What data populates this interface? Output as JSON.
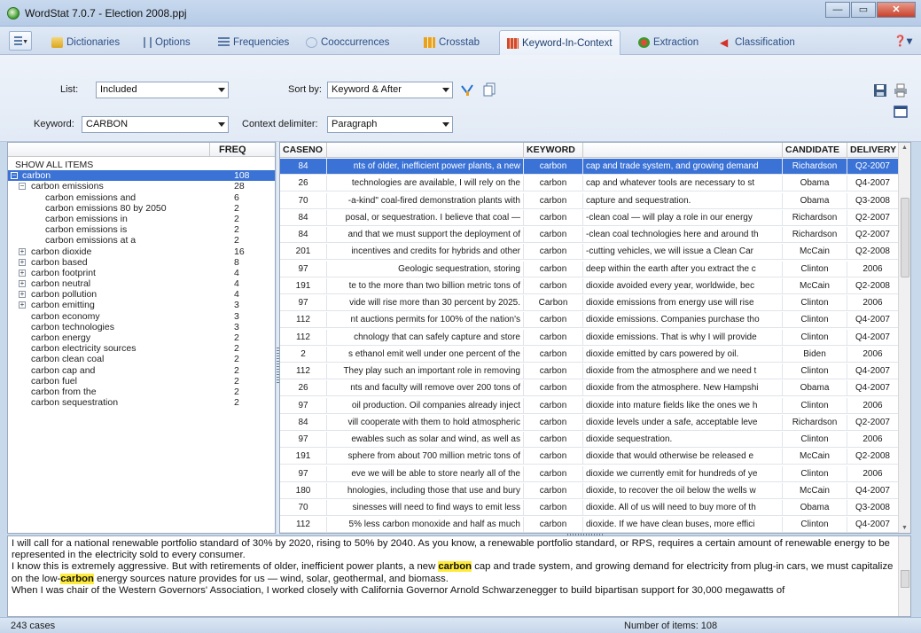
{
  "window": {
    "title": "WordStat 7.0.7 - Election 2008.ppj"
  },
  "tabs": [
    {
      "label": "Dictionaries",
      "icon": "book-icon"
    },
    {
      "label": "Options",
      "icon": "options-icon"
    },
    {
      "label": "Frequencies",
      "icon": "list-icon"
    },
    {
      "label": "Cooccurrences",
      "icon": "network-icon"
    },
    {
      "label": "Crosstab",
      "icon": "table-icon"
    },
    {
      "label": "Keyword-In-Context",
      "icon": "kwic-icon"
    },
    {
      "label": "Extraction",
      "icon": "extraction-icon"
    },
    {
      "label": "Classification",
      "icon": "classification-icon"
    }
  ],
  "toolbar": {
    "list_label": "List:",
    "list_value": "Included",
    "keyword_label": "Keyword:",
    "keyword_value": "CARBON",
    "sort_label": "Sort by:",
    "sort_value": "Keyword & After",
    "context_label": "Context delimiter:",
    "context_value": "Paragraph"
  },
  "left_panel": {
    "freq_header": "FREQ",
    "show_all": "SHOW ALL ITEMS",
    "items": [
      {
        "label": "carbon",
        "count": "108",
        "level": 0,
        "expander": "−",
        "selected": true
      },
      {
        "label": "carbon emissions",
        "count": "28",
        "level": 1,
        "expander": "−"
      },
      {
        "label": "carbon emissions and",
        "count": "6",
        "level": 2,
        "expander": ""
      },
      {
        "label": "carbon emissions 80 by 2050",
        "count": "2",
        "level": 2,
        "expander": ""
      },
      {
        "label": "carbon emissions in",
        "count": "2",
        "level": 2,
        "expander": ""
      },
      {
        "label": "carbon emissions is",
        "count": "2",
        "level": 2,
        "expander": ""
      },
      {
        "label": "carbon emissions at a",
        "count": "2",
        "level": 2,
        "expander": ""
      },
      {
        "label": "carbon dioxide",
        "count": "16",
        "level": 1,
        "expander": "+"
      },
      {
        "label": "carbon based",
        "count": "8",
        "level": 1,
        "expander": "+"
      },
      {
        "label": "carbon footprint",
        "count": "4",
        "level": 1,
        "expander": "+"
      },
      {
        "label": "carbon neutral",
        "count": "4",
        "level": 1,
        "expander": "+"
      },
      {
        "label": "carbon pollution",
        "count": "4",
        "level": 1,
        "expander": "+"
      },
      {
        "label": "carbon emitting",
        "count": "3",
        "level": 1,
        "expander": "+"
      },
      {
        "label": "carbon economy",
        "count": "3",
        "level": 1,
        "expander": ""
      },
      {
        "label": "carbon technologies",
        "count": "3",
        "level": 1,
        "expander": ""
      },
      {
        "label": "carbon energy",
        "count": "2",
        "level": 1,
        "expander": ""
      },
      {
        "label": "carbon electricity sources",
        "count": "2",
        "level": 1,
        "expander": ""
      },
      {
        "label": "carbon clean coal",
        "count": "2",
        "level": 1,
        "expander": ""
      },
      {
        "label": "carbon cap and",
        "count": "2",
        "level": 1,
        "expander": ""
      },
      {
        "label": "carbon fuel",
        "count": "2",
        "level": 1,
        "expander": ""
      },
      {
        "label": "carbon from the",
        "count": "2",
        "level": 1,
        "expander": ""
      },
      {
        "label": "carbon sequestration",
        "count": "2",
        "level": 1,
        "expander": ""
      }
    ]
  },
  "grid": {
    "headers": {
      "caseno": "CASENO",
      "keyword": "KEYWORD",
      "candidate": "CANDIDATE",
      "delivery": "DELIVERY"
    },
    "rows": [
      {
        "caseno": "84",
        "left": "nts of older, inefficient power plants, a new",
        "keyword": "carbon",
        "right": "cap and trade system, and growing demand",
        "candidate": "Richardson",
        "delivery": "Q2-2007",
        "selected": true
      },
      {
        "caseno": "26",
        "left": "technologies are available, I will rely on the",
        "keyword": "carbon",
        "right": "cap and whatever tools are necessary to st",
        "candidate": "Obama",
        "delivery": "Q4-2007"
      },
      {
        "caseno": "70",
        "left": "-a-kind\" coal-fired demonstration plants with",
        "keyword": "carbon",
        "right": "capture and sequestration.",
        "candidate": "Obama",
        "delivery": "Q3-2008"
      },
      {
        "caseno": "84",
        "left": "posal, or sequestration. I believe that coal —",
        "keyword": "carbon",
        "right": "-clean coal — will play a role in our energy",
        "candidate": "Richardson",
        "delivery": "Q2-2007"
      },
      {
        "caseno": "84",
        "left": "and that we must support the deployment of",
        "keyword": "carbon",
        "right": "-clean coal technologies here and around th",
        "candidate": "Richardson",
        "delivery": "Q2-2007"
      },
      {
        "caseno": "201",
        "left": "incentives and credits for hybrids and other",
        "keyword": "carbon",
        "right": "-cutting vehicles, we will issue a Clean Car",
        "candidate": "McCain",
        "delivery": "Q2-2008"
      },
      {
        "caseno": "97",
        "left": "Geologic sequestration, storing",
        "keyword": "carbon",
        "right": "deep within the earth after you extract the c",
        "candidate": "Clinton",
        "delivery": "2006"
      },
      {
        "caseno": "191",
        "left": "te to the more than two billion metric tons of",
        "keyword": "carbon",
        "right": "dioxide avoided every year, worldwide, bec",
        "candidate": "McCain",
        "delivery": "Q2-2008"
      },
      {
        "caseno": "97",
        "left": "vide will rise more than 30 percent by 2025.",
        "keyword": "Carbon",
        "right": "dioxide emissions from energy use will rise",
        "candidate": "Clinton",
        "delivery": "2006"
      },
      {
        "caseno": "112",
        "left": "nt auctions permits for 100% of the nation's",
        "keyword": "carbon",
        "right": "dioxide emissions. Companies purchase tho",
        "candidate": "Clinton",
        "delivery": "Q4-2007"
      },
      {
        "caseno": "112",
        "left": "chnology that can safely capture and store",
        "keyword": "carbon",
        "right": "dioxide emissions. That is why I will provide",
        "candidate": "Clinton",
        "delivery": "Q4-2007"
      },
      {
        "caseno": "2",
        "left": "s ethanol emit well under one percent of the",
        "keyword": "carbon",
        "right": "dioxide emitted by cars powered by oil.",
        "candidate": "Biden",
        "delivery": "2006"
      },
      {
        "caseno": "112",
        "left": "They play such an important role in removing",
        "keyword": "carbon",
        "right": "dioxide from the atmosphere and we need t",
        "candidate": "Clinton",
        "delivery": "Q4-2007"
      },
      {
        "caseno": "26",
        "left": "nts and faculty will remove over 200 tons of",
        "keyword": "carbon",
        "right": "dioxide from the atmosphere. New Hampshi",
        "candidate": "Obama",
        "delivery": "Q4-2007"
      },
      {
        "caseno": "97",
        "left": "oil production. Oil companies already inject",
        "keyword": "carbon",
        "right": "dioxide into mature fields like the ones we h",
        "candidate": "Clinton",
        "delivery": "2006"
      },
      {
        "caseno": "84",
        "left": "vill cooperate with them to hold atmospheric",
        "keyword": "carbon",
        "right": "dioxide levels under a safe, acceptable leve",
        "candidate": "Richardson",
        "delivery": "Q2-2007"
      },
      {
        "caseno": "97",
        "left": "ewables such as solar and wind, as well as",
        "keyword": "carbon",
        "right": "dioxide sequestration.",
        "candidate": "Clinton",
        "delivery": "2006"
      },
      {
        "caseno": "191",
        "left": "sphere from about 700 million metric tons of",
        "keyword": "carbon",
        "right": "dioxide that would otherwise be released e",
        "candidate": "McCain",
        "delivery": "Q2-2008"
      },
      {
        "caseno": "97",
        "left": "eve we will be able to store nearly all of the",
        "keyword": "carbon",
        "right": "dioxide we currently emit for hundreds of ye",
        "candidate": "Clinton",
        "delivery": "2006"
      },
      {
        "caseno": "180",
        "left": "hnologies, including those that use and bury",
        "keyword": "carbon",
        "right": "dioxide, to recover the oil below the wells w",
        "candidate": "McCain",
        "delivery": "Q4-2007"
      },
      {
        "caseno": "70",
        "left": "sinesses will need to find ways to emit less",
        "keyword": "carbon",
        "right": "dioxide. All of us will need to buy more of th",
        "candidate": "Obama",
        "delivery": "Q3-2008"
      },
      {
        "caseno": "112",
        "left": "5% less carbon monoxide and half as much",
        "keyword": "carbon",
        "right": "dioxide. If we have clean buses, more effici",
        "candidate": "Clinton",
        "delivery": "Q4-2007"
      }
    ]
  },
  "text_pane": {
    "p1": "I will call for a national renewable portfolio standard of 30% by 2020, rising to 50% by 2040. As you know, a renewable portfolio standard, or RPS, requires a certain amount of renewable energy to be represented in the electricity sold to every consumer.",
    "p2_a": "I know this is extremely aggressive. But with retirements of older, inefficient power plants, a new ",
    "p2_kw": "carbon",
    "p2_b": " cap and trade system, and growing demand for electricity from plug-in cars, we must capitalize on the low-",
    "p2_kw2": "carbon",
    "p2_c": " energy sources nature provides for us — wind, solar, geothermal, and biomass.",
    "p3": "When I was chair of the Western Governors' Association, I worked closely with California Governor Arnold Schwarzenegger to build bipartisan support for 30,000 megawatts of"
  },
  "status": {
    "cases": "243 cases",
    "items": "Number of items: 108"
  },
  "colors": {
    "selection": "#3a72d6",
    "highlight": "#ffeb3b",
    "accent": "#2c4f86"
  }
}
